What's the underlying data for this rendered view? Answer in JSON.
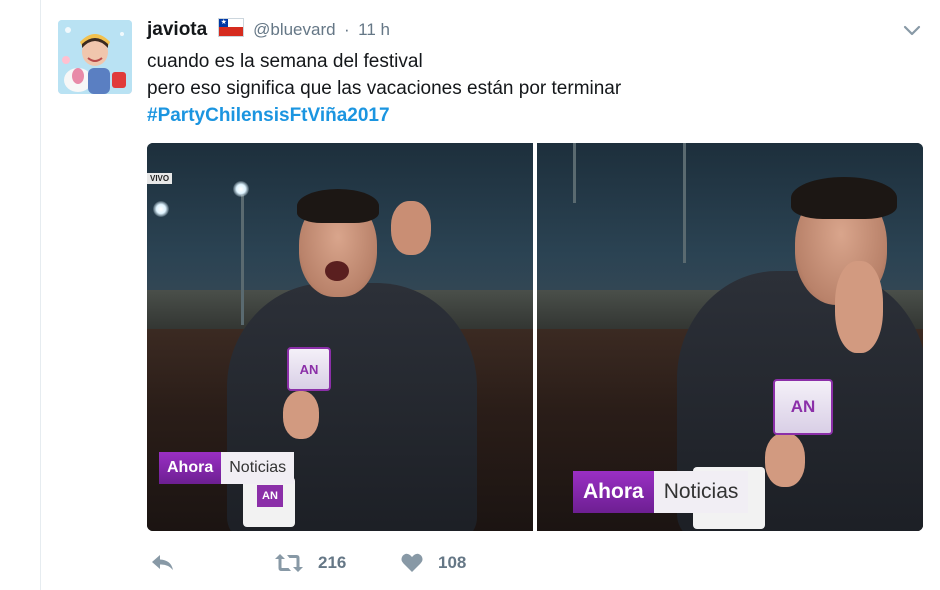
{
  "tweet": {
    "fullname": "javiota",
    "username": "@bluevard",
    "separator": "·",
    "time": "11 h",
    "text_lines": [
      "cuando es la semana del festival",
      "pero eso significa que las vacaciones están por terminar"
    ],
    "hashtag": "#PartyChilensisFtViña2017"
  },
  "media": {
    "left": {
      "live_tag": "VIVO",
      "mic_logo": "AN",
      "lower_third_a": "Ahora",
      "lower_third_b": "Noticias",
      "mug_logo": "AN"
    },
    "right": {
      "mic_logo": "AN",
      "lower_third_a": "Ahora",
      "lower_third_b": "Noticias"
    }
  },
  "actions": {
    "reply_icon": "reply-icon",
    "retweet_icon": "retweet-icon",
    "retweet_count": "216",
    "like_icon": "heart-icon",
    "like_count": "108"
  },
  "colors": {
    "hashtag": "#1b95e0",
    "meta_gray": "#657786",
    "brand_purple": "#8b2fa8"
  }
}
